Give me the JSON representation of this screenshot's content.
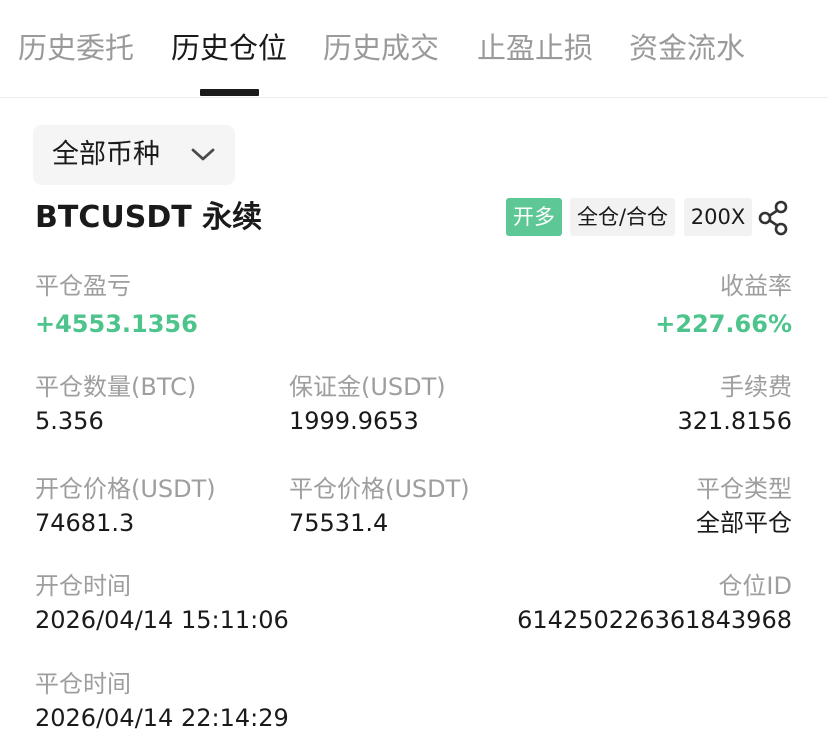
{
  "tabs": [
    {
      "label": "历史委托",
      "active": false
    },
    {
      "label": "历史仓位",
      "active": true
    },
    {
      "label": "历史成交",
      "active": false
    },
    {
      "label": "止盈止损",
      "active": false
    },
    {
      "label": "资金流水",
      "active": false
    }
  ],
  "filter": {
    "label": "全部币种",
    "icon": "chevron-down-icon"
  },
  "position": {
    "symbol": "BTCUSDT 永续",
    "side_tag": "开多",
    "margin_mode_tag": "全仓/合仓",
    "leverage_tag": "200X",
    "share_icon": "share-icon",
    "pnl_label": "平仓盈亏",
    "pnl_value": "+4553.1356",
    "roi_label": "收益率",
    "roi_value": "+227.66%",
    "close_qty_label": "平仓数量(BTC)",
    "close_qty_value": "5.356",
    "margin_label": "保证金(USDT)",
    "margin_value": "1999.9653",
    "fee_label": "手续费",
    "fee_value": "321.8156",
    "open_price_label": "开仓价格(USDT)",
    "open_price_value": "74681.3",
    "close_price_label": "平仓价格(USDT)",
    "close_price_value": "75531.4",
    "close_type_label": "平仓类型",
    "close_type_value": "全部平仓",
    "open_time_label": "开仓时间",
    "open_time_value": "2026/04/14 15:11:06",
    "position_id_label": "仓位ID",
    "position_id_value": "614250226361843968",
    "close_time_label": "平仓时间",
    "close_time_value": "2026/04/14 22:14:29"
  },
  "colors": {
    "profit_green": "#4cc48b",
    "tag_green": "#5dc796",
    "muted": "#9e9e9e"
  }
}
